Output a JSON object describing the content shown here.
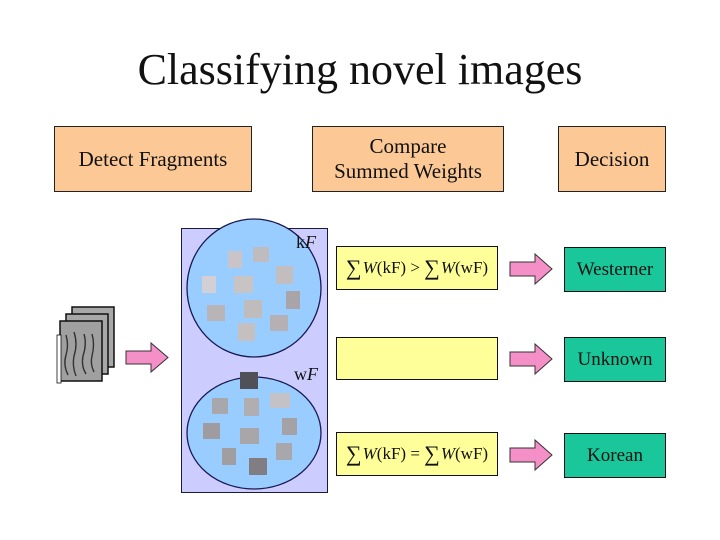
{
  "title": "Classifying novel images",
  "stages": [
    {
      "label": "Detect Fragments"
    },
    {
      "label_line1": "Compare",
      "label_line2": "Summed Weights"
    },
    {
      "label": "Decision"
    }
  ],
  "fragment_sets": {
    "top": {
      "label_prefix": "k",
      "label_var": "F",
      "fragment_count": 10,
      "description": "face fragments"
    },
    "bottom": {
      "label_prefix": "w",
      "label_var": "F",
      "fragment_count": 10,
      "description": "eye fragments"
    }
  },
  "conditions": [
    {
      "sigma": "∑",
      "W": "W",
      "lhs": "(kF)",
      "op": ">",
      "sigma2": "∑",
      "W2": "W",
      "rhs": "(wF)"
    },
    {
      "sigma": "",
      "W": "",
      "lhs": "",
      "op": "",
      "sigma2": "",
      "W2": "",
      "rhs": ""
    },
    {
      "sigma": "∑",
      "W": "W",
      "lhs": "(kF)",
      "op": "=",
      "sigma2": "∑",
      "W2": "W",
      "rhs": "(wF)"
    }
  ],
  "results": [
    {
      "label": "Westerner"
    },
    {
      "label": "Unknown"
    },
    {
      "label": "Korean"
    }
  ],
  "input": {
    "description": "stack of novel images",
    "count": 3
  },
  "colors": {
    "stage_fill": "#fcc996",
    "panel_fill": "#ccccff",
    "circle_fill": "#99ccff",
    "condition_fill": "#ffff99",
    "result_fill": "#19c79a",
    "arrow_fill": "#f48fc8"
  }
}
